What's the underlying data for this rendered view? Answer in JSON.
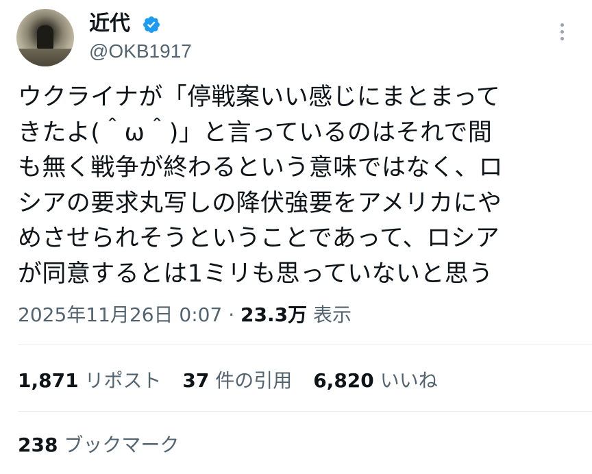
{
  "author": {
    "name": "近代",
    "handle": "@OKB1917",
    "verified_color": "#1d9bf0"
  },
  "tweet": {
    "text": "ウクライナが「停戦案いい感じにまとまって\nきたよ(＾ω＾)」と言っているのはそれで間\nも無く戦争が終わるという意味ではなく、ロ\nシアの要求丸写しの降伏強要をアメリカにや\nめさせられそうということであって、ロシア\nが同意するとは1ミリも思っていないと思う",
    "timestamp": "2025年11月26日 0:07",
    "separator": "·",
    "views_count": "23.3万",
    "views_label": "表示"
  },
  "stats": {
    "reposts": {
      "count": "1,871",
      "label": "リポスト"
    },
    "quotes": {
      "count": "37",
      "label": "件の引用"
    },
    "likes": {
      "count": "6,820",
      "label": "いいね"
    },
    "bookmarks": {
      "count": "238",
      "label": "ブックマーク"
    }
  },
  "icons": {
    "verified": "verified-badge-icon",
    "more": "more-vertical-icon"
  }
}
